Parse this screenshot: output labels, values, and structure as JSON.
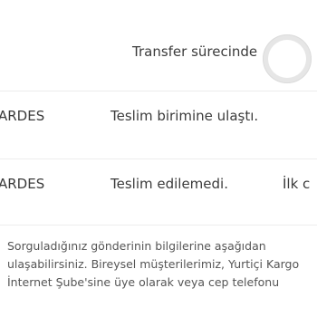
{
  "rows": [
    {
      "left": "",
      "status": "Transfer sürecinde",
      "right": ""
    },
    {
      "left": "ARDES",
      "status": "Teslim birimine ulaştı.",
      "right": ""
    },
    {
      "left": "ARDES",
      "status": "Teslim edilemedi.",
      "right": "İlk c"
    }
  ],
  "info": {
    "line1": "Sorguladığınız gönderinin bilgilerine aşağıdan",
    "line2": "ulaşabilirsiniz. Bireysel müşterilerimiz, Yurtiçi Kargo",
    "line3": "İnternet Şube'sine üye olarak veya cep telefonu"
  },
  "colors": {
    "text": "#3b3b3b",
    "info_text": "#555555",
    "divider": "#ededed",
    "status_ring": "#e6e6e6"
  }
}
